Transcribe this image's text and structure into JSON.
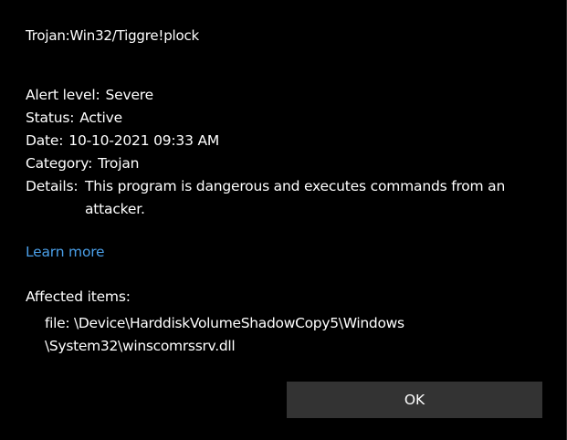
{
  "threat": {
    "name": "Trojan:Win32/Tiggre!plock"
  },
  "details": {
    "alert_level_label": "Alert level:",
    "alert_level_value": "Severe",
    "status_label": "Status:",
    "status_value": "Active",
    "date_label": "Date:",
    "date_value": "10-10-2021 09:33 AM",
    "category_label": "Category:",
    "category_value": "Trojan",
    "details_label": "Details:",
    "details_value": "This program is dangerous and executes commands from an attacker."
  },
  "links": {
    "learn_more": "Learn more"
  },
  "affected": {
    "title": "Affected items:",
    "item": "file: \\Device\\HarddiskVolumeShadowCopy5\\Windows \\System32\\winscomrssrv.dll"
  },
  "actions": {
    "ok_label": "OK"
  },
  "colors": {
    "background": "#000000",
    "text": "#ffffff",
    "link": "#4a9fe8",
    "button": "#333333"
  }
}
